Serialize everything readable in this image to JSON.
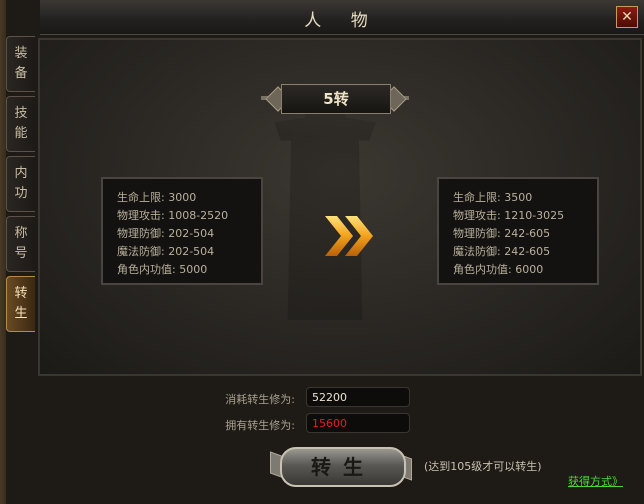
{
  "window": {
    "title": "人 物",
    "close_symbol": "✕"
  },
  "tabs": [
    {
      "label": "装备",
      "line1": "装",
      "line2": "备",
      "active": false
    },
    {
      "label": "技能",
      "line1": "技",
      "line2": "能",
      "active": false
    },
    {
      "label": "内功",
      "line1": "内",
      "line2": "功",
      "active": false
    },
    {
      "label": "称号",
      "line1": "称",
      "line2": "号",
      "active": false
    },
    {
      "label": "转生",
      "line1": "转",
      "line2": "生",
      "active": true
    }
  ],
  "rebirth": {
    "level_label": "5转",
    "current_stats": [
      {
        "label": "生命上限:",
        "value": "3000"
      },
      {
        "label": "物理攻击:",
        "value": "1008-2520"
      },
      {
        "label": "物理防御:",
        "value": "202-504"
      },
      {
        "label": "魔法防御:",
        "value": "202-504"
      },
      {
        "label": "角色内功值:",
        "value": "5000"
      }
    ],
    "next_stats": [
      {
        "label": "生命上限:",
        "value": "3500"
      },
      {
        "label": "物理攻击:",
        "value": "1210-3025"
      },
      {
        "label": "物理防御:",
        "value": "242-605"
      },
      {
        "label": "魔法防御:",
        "value": "242-605"
      },
      {
        "label": "角色内功值:",
        "value": "6000"
      }
    ],
    "cost_label": "消耗转生修为:",
    "cost_value": "52200",
    "owned_label": "拥有转生修为:",
    "owned_value": "15600",
    "button_label": "转生",
    "hint": "(达到105级才可以转生)",
    "obtain_link": "获得方式》"
  },
  "colors": {
    "cost_value": "#e8e2d0",
    "owned_value": "#e02020",
    "arrow": "#f0a020",
    "link": "#4cd83a"
  }
}
